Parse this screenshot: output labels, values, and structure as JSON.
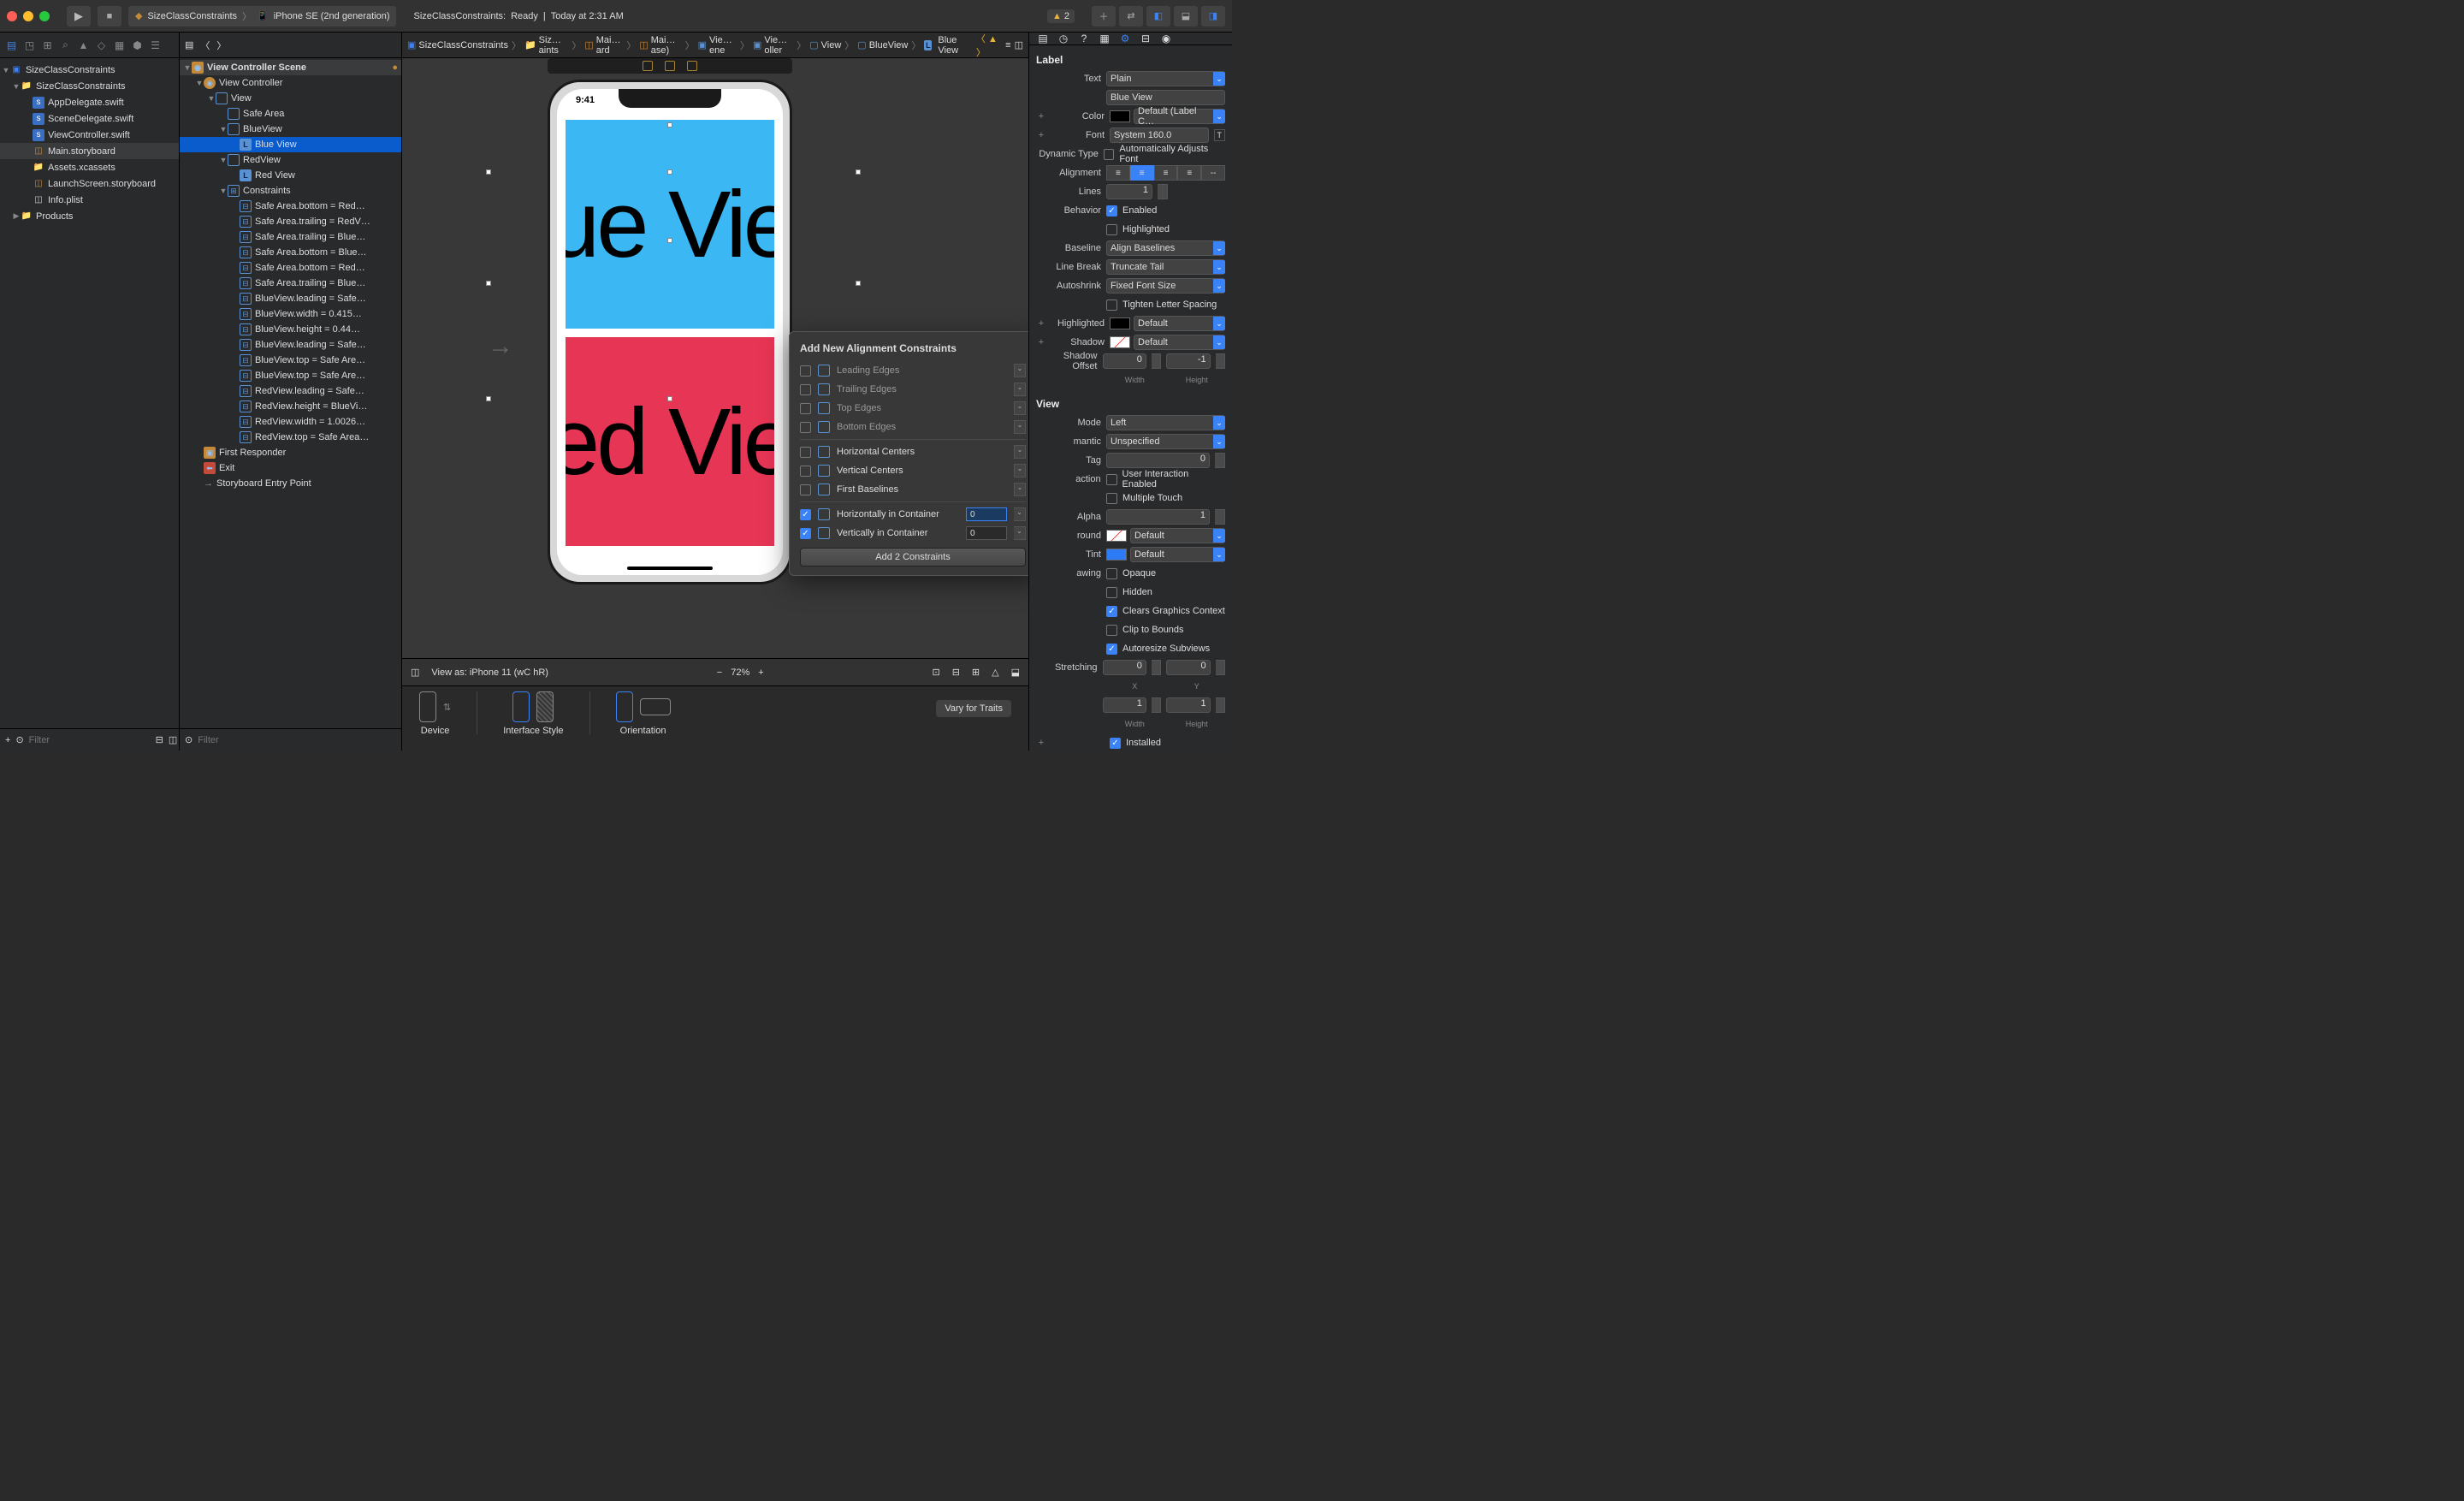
{
  "title": {
    "scheme_app": "SizeClassConstraints",
    "scheme_sep": "〉",
    "scheme_dev": "iPhone SE (2nd generation)",
    "status_app": "SizeClassConstraints:",
    "status_state": "Ready",
    "status_sep": "|",
    "status_time": "Today at 2:31 AM",
    "warn_count": "2"
  },
  "nav": {
    "root": "SizeClassConstraints",
    "group": "SizeClassConstraints",
    "files": [
      "AppDelegate.swift",
      "SceneDelegate.swift",
      "ViewController.swift",
      "Main.storyboard",
      "Assets.xcassets",
      "LaunchScreen.storyboard",
      "Info.plist"
    ],
    "products": "Products",
    "filter_ph": "Filter",
    "add": "+"
  },
  "outline": {
    "scene": "View Controller Scene",
    "vc": "View Controller",
    "view": "View",
    "safe": "Safe Area",
    "blue": "BlueView",
    "bluelab": "Blue View",
    "red": "RedView",
    "redlab": "Red View",
    "cons": "Constraints",
    "clist": [
      "Safe Area.bottom = Red…",
      "Safe Area.trailing = RedV…",
      "Safe Area.trailing = Blue…",
      "Safe Area.bottom = Blue…",
      "Safe Area.bottom = Red…",
      "Safe Area.trailing = Blue…",
      "BlueView.leading = Safe…",
      "BlueView.width = 0.415…",
      "BlueView.height = 0.44…",
      "BlueView.leading = Safe…",
      "BlueView.top = Safe Are…",
      "BlueView.top = Safe Are…",
      "RedView.leading = Safe…",
      "RedView.height = BlueVi…",
      "RedView.width = 1.0026…",
      "RedView.top = Safe Area…"
    ],
    "fr": "First Responder",
    "exit": "Exit",
    "entry": "Storyboard Entry Point",
    "filter_ph": "Filter"
  },
  "jump": [
    "SizeClassConstraints",
    "Siz…aints",
    "Mai…ard",
    "Mai…ase)",
    "Vie…ene",
    "Vie…oller",
    "View",
    "BlueView",
    "Blue View"
  ],
  "canvas": {
    "time": "9:41",
    "blue_txt": "ue Vie",
    "red_txt": "ed Vie",
    "view_as": "View as: iPhone 11 (wC hR)",
    "zoom": "72%",
    "device": "Device",
    "style": "Interface Style",
    "orient": "Orientation",
    "vary": "Vary for Traits"
  },
  "popover": {
    "title": "Add New Alignment Constraints",
    "rows": [
      {
        "l": "Leading Edges",
        "en": false
      },
      {
        "l": "Trailing Edges",
        "en": false
      },
      {
        "l": "Top Edges",
        "en": false
      },
      {
        "l": "Bottom Edges",
        "en": false
      },
      {
        "l": "Horizontal Centers",
        "en": true,
        "chk": false
      },
      {
        "l": "Vertical Centers",
        "en": true,
        "chk": false
      },
      {
        "l": "First Baselines",
        "en": true,
        "chk": false
      },
      {
        "l": "Horizontally in Container",
        "en": true,
        "chk": true,
        "v": "0",
        "hl": true
      },
      {
        "l": "Vertically in Container",
        "en": true,
        "chk": true,
        "v": "0"
      }
    ],
    "btn": "Add 2 Constraints"
  },
  "insp": {
    "label_head": "Label",
    "text_l": "Text",
    "text_v": "Plain",
    "text_content": "Blue View",
    "color_l": "Color",
    "color_v": "Default (Label C…",
    "font_l": "Font",
    "font_v": "System 160.0",
    "dyn_l": "Dynamic Type",
    "dyn_v": "Automatically Adjusts Font",
    "align_l": "Alignment",
    "lines_l": "Lines",
    "lines_v": "1",
    "beh_l": "Behavior",
    "beh_en": "Enabled",
    "beh_hl": "Highlighted",
    "base_l": "Baseline",
    "base_v": "Align Baselines",
    "lbrk_l": "Line Break",
    "lbrk_v": "Truncate Tail",
    "ashr_l": "Autoshrink",
    "ashr_v": "Fixed Font Size",
    "ashr_t": "Tighten Letter Spacing",
    "hil_l": "Highlighted",
    "hil_v": "Default",
    "shd_l": "Shadow",
    "shd_v": "Default",
    "soff_l": "Shadow Offset",
    "soff_w": "0",
    "soff_h": "-1",
    "soff_wl": "Width",
    "soff_hl": "Height",
    "view_head": "View",
    "mode_l": "Mode",
    "mode_v": "Left",
    "sem_l": "mantic",
    "sem_v": "Unspecified",
    "tag_l": "Tag",
    "tag_v": "0",
    "int_l": "action",
    "int_u": "User Interaction Enabled",
    "int_m": "Multiple Touch",
    "alpha_l": "Alpha",
    "alpha_v": "1",
    "bg_l": "round",
    "bg_v": "Default",
    "tint_l": "Tint",
    "tint_v": "Default",
    "draw_l": "awing",
    "draw": [
      "Opaque",
      "Hidden",
      "Clears Graphics Context",
      "Clip to Bounds",
      "Autoresize Subviews"
    ],
    "draw_chk": [
      false,
      false,
      true,
      false,
      true
    ],
    "str_l": "Stretching",
    "str_x": "0",
    "str_y": "0",
    "str_xl": "X",
    "str_yl": "Y",
    "str_w": "1",
    "str_h": "1",
    "str_wl": "Width",
    "str_hl": "Height",
    "inst_l": "Installed"
  }
}
